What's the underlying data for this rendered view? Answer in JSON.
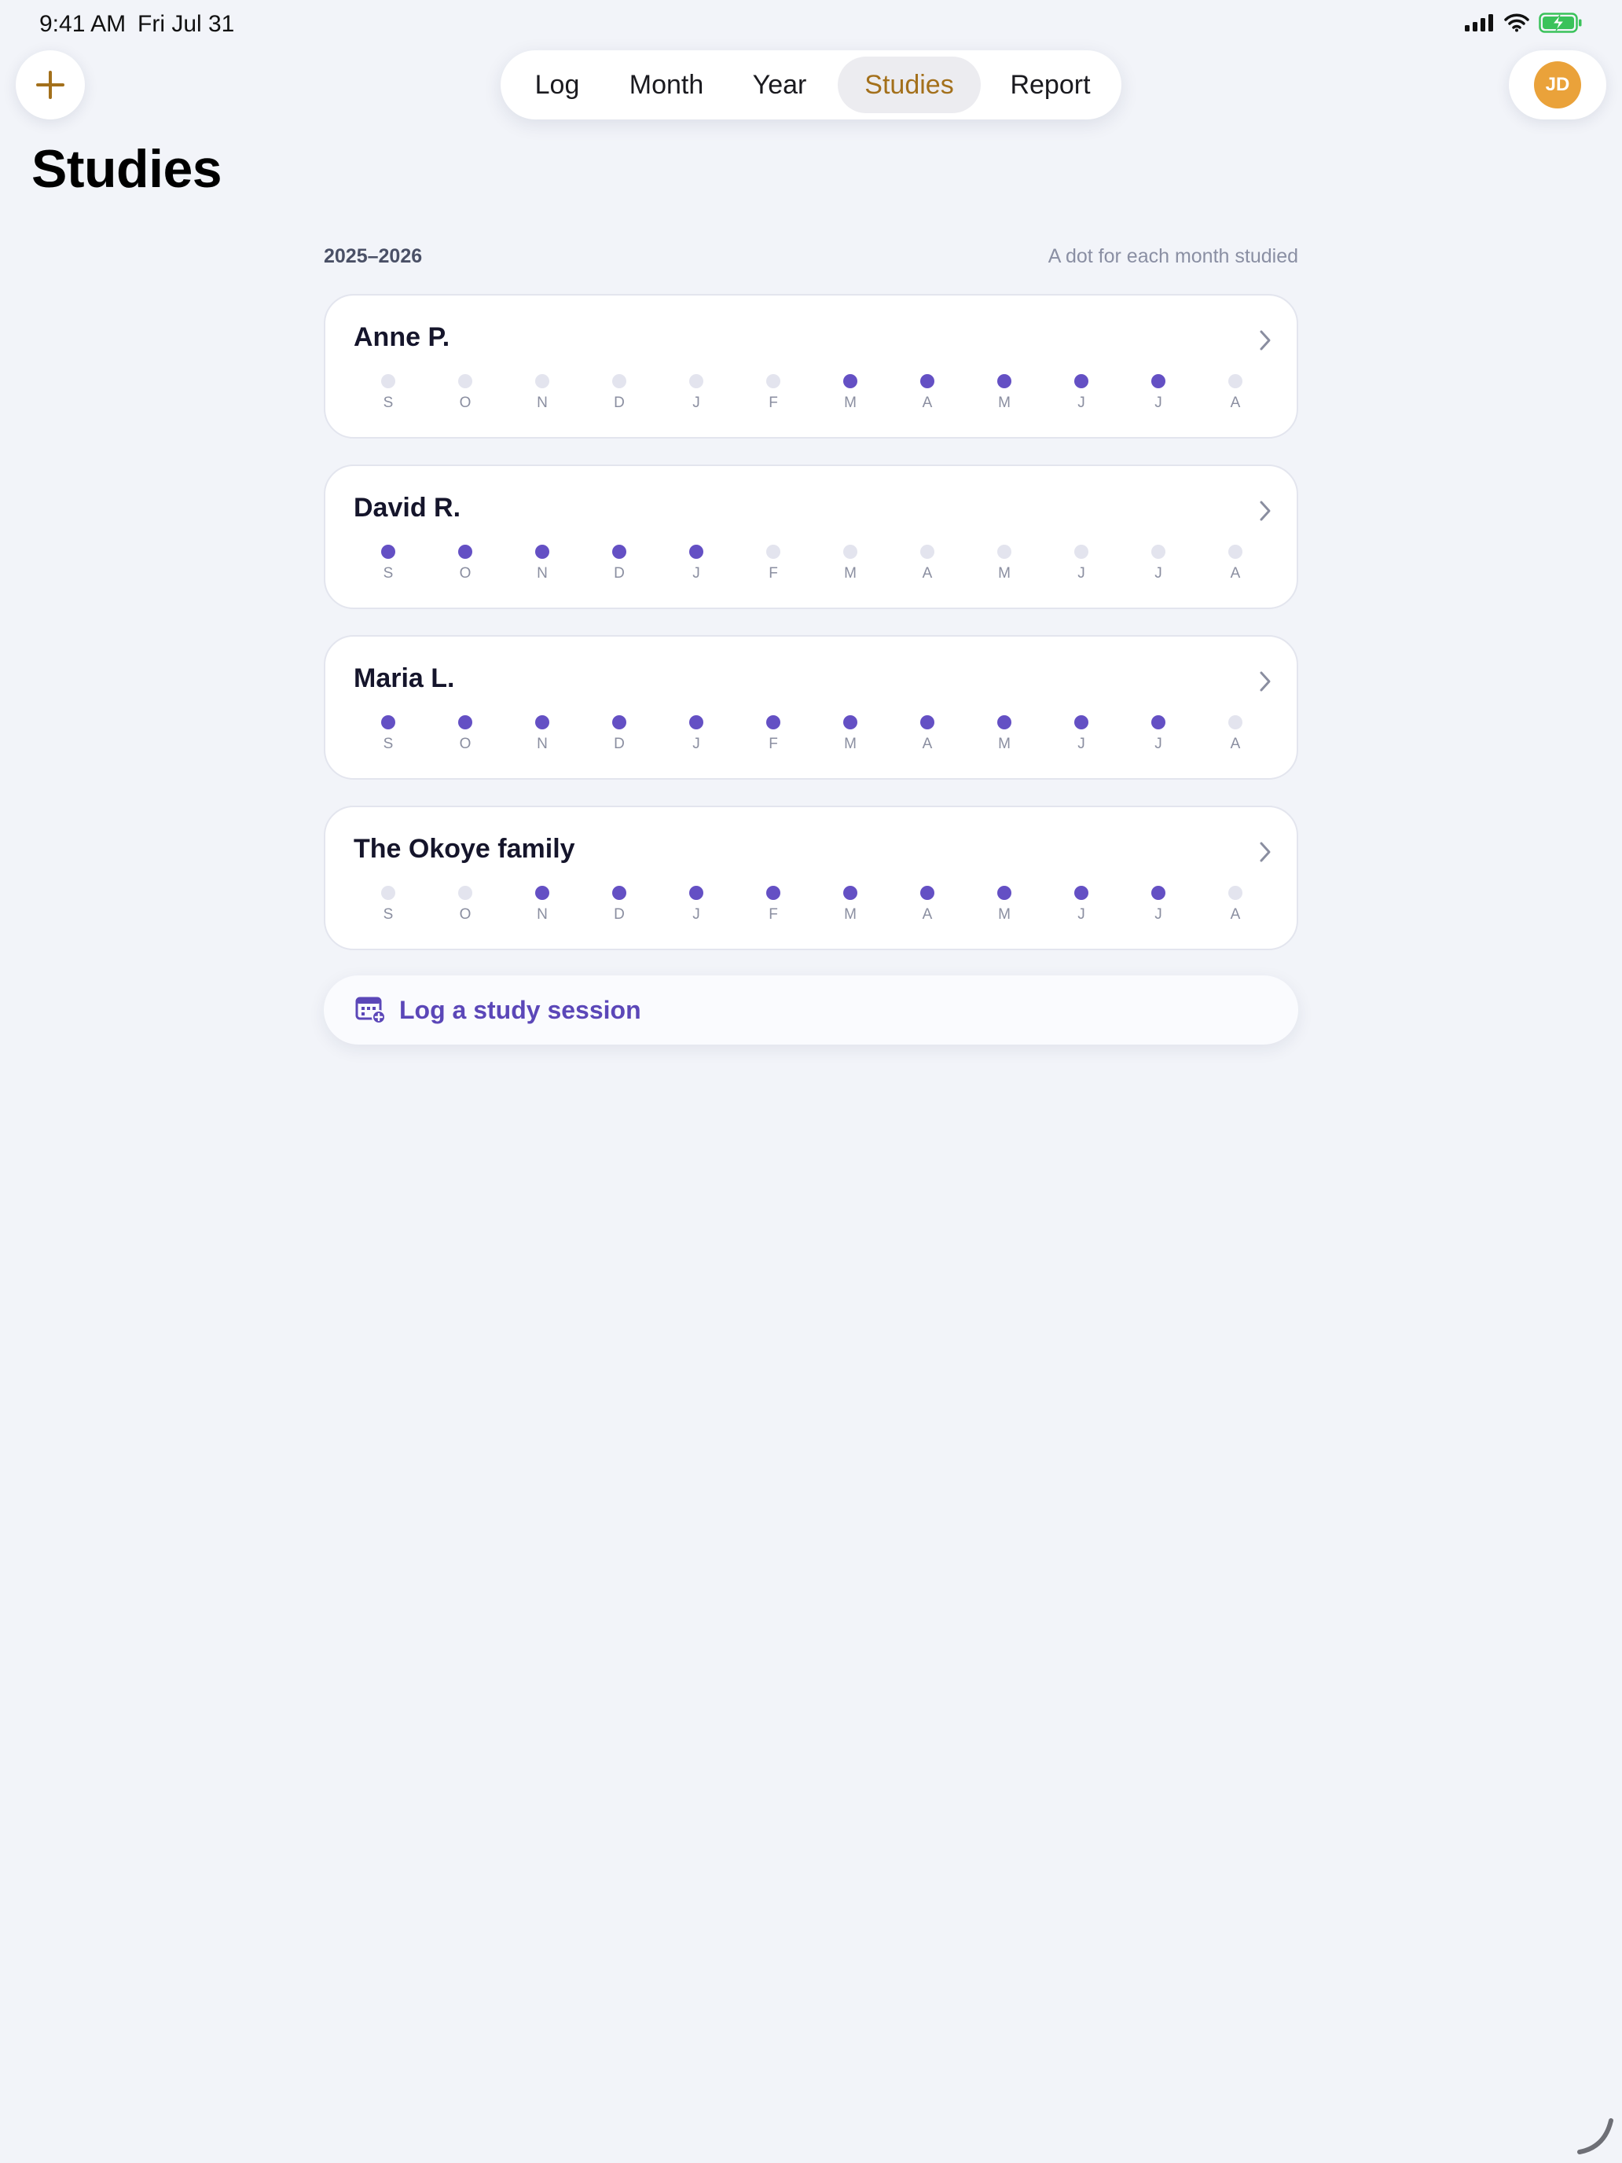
{
  "status_bar": {
    "time": "9:41 AM",
    "date": "Fri Jul 31"
  },
  "nav": {
    "tabs": [
      {
        "label": "Log",
        "selected": false
      },
      {
        "label": "Month",
        "selected": false
      },
      {
        "label": "Year",
        "selected": false
      },
      {
        "label": "Studies",
        "selected": true
      },
      {
        "label": "Report",
        "selected": false
      }
    ],
    "avatar_initials": "JD"
  },
  "page": {
    "title": "Studies",
    "year_label": "2025–2026",
    "hint": "A dot for each month studied"
  },
  "months": [
    "S",
    "O",
    "N",
    "D",
    "J",
    "F",
    "M",
    "A",
    "M",
    "J",
    "J",
    "A"
  ],
  "studies": [
    {
      "name": "Anne P.",
      "studied": [
        false,
        false,
        false,
        false,
        false,
        false,
        true,
        true,
        true,
        true,
        true,
        false
      ]
    },
    {
      "name": "David R.",
      "studied": [
        true,
        true,
        true,
        true,
        true,
        false,
        false,
        false,
        false,
        false,
        false,
        false
      ]
    },
    {
      "name": "Maria L.",
      "studied": [
        true,
        true,
        true,
        true,
        true,
        true,
        true,
        true,
        true,
        true,
        true,
        false
      ]
    },
    {
      "name": "The Okoye family",
      "studied": [
        false,
        false,
        true,
        true,
        true,
        true,
        true,
        true,
        true,
        true,
        true,
        false
      ]
    }
  ],
  "actions": {
    "log_session": "Log a study session"
  },
  "colors": {
    "accent": "#6450c4",
    "dot_off": "#e3e4ee",
    "tab_selected": "#a3701b",
    "avatar": "#eaa23a",
    "background": "#f2f4f9"
  },
  "icons": [
    "plus-icon",
    "chevron-right-icon",
    "calendar-add-icon",
    "signal-icon",
    "wifi-icon",
    "battery-icon"
  ]
}
